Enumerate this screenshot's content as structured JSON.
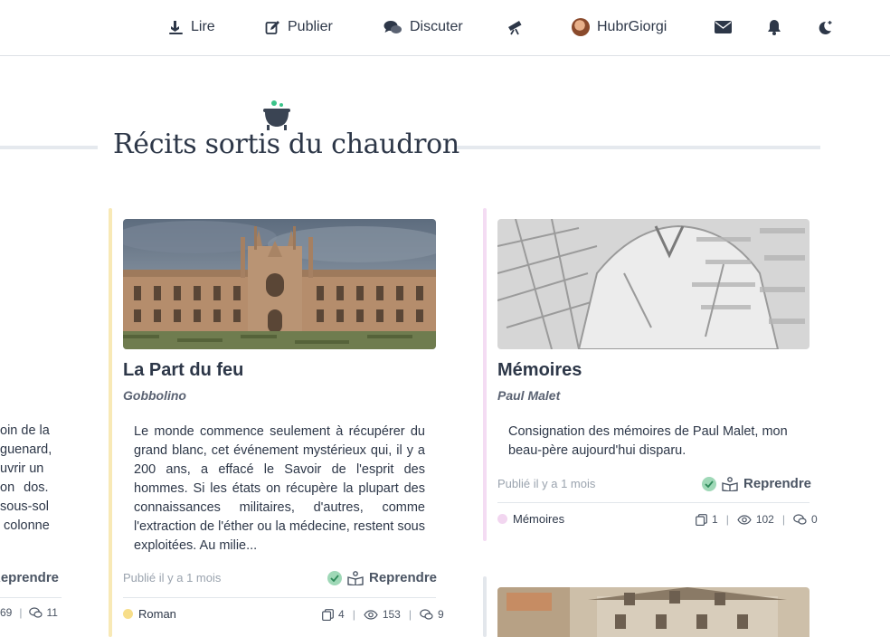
{
  "nav": {
    "read": "Lire",
    "publish": "Publier",
    "discuss": "Discuter",
    "username": "HubrGiorgi"
  },
  "section": {
    "title": "Récits sortis du chaudron"
  },
  "left_card": {
    "desc_lines": [
      "oin de la",
      "guenard,",
      "uvrir un",
      "on  dos.",
      "sous-sol",
      "colonne"
    ],
    "resume": "Reprendre",
    "stat_tail": "69",
    "comments": "11"
  },
  "cards": [
    {
      "title": "La Part du feu",
      "author": "Gobbolino",
      "description": "Le monde commence seulement à récupérer du grand blanc, cet événement mystérieux qui, il y a 200 ans, a effacé le Savoir de l'esprit des hommes. Si les états on récupère la plupart des connaissances militaires, d'autres, comme l'extraction de l'éther ou la médecine, restent sous exploitées. Au milie...",
      "date": "Publié il y a 1 mois",
      "resume": "Reprendre",
      "tag": "Roman",
      "tag_color": "#f7de8a",
      "bar_color": "#f8e9b6",
      "chapters": "4",
      "views": "153",
      "comments": "9"
    },
    {
      "title": "Mémoires",
      "author": "Paul Malet",
      "description": "Consignation des mémoires de Paul Malet, mon beau-père aujourd'hui disparu.",
      "date": "Publié il y a 1 mois",
      "resume": "Reprendre",
      "tag": "Mémoires",
      "tag_color": "#f2d6f0",
      "bar_color": "#f4dcf3",
      "chapters": "1",
      "views": "102",
      "comments": "0"
    }
  ]
}
